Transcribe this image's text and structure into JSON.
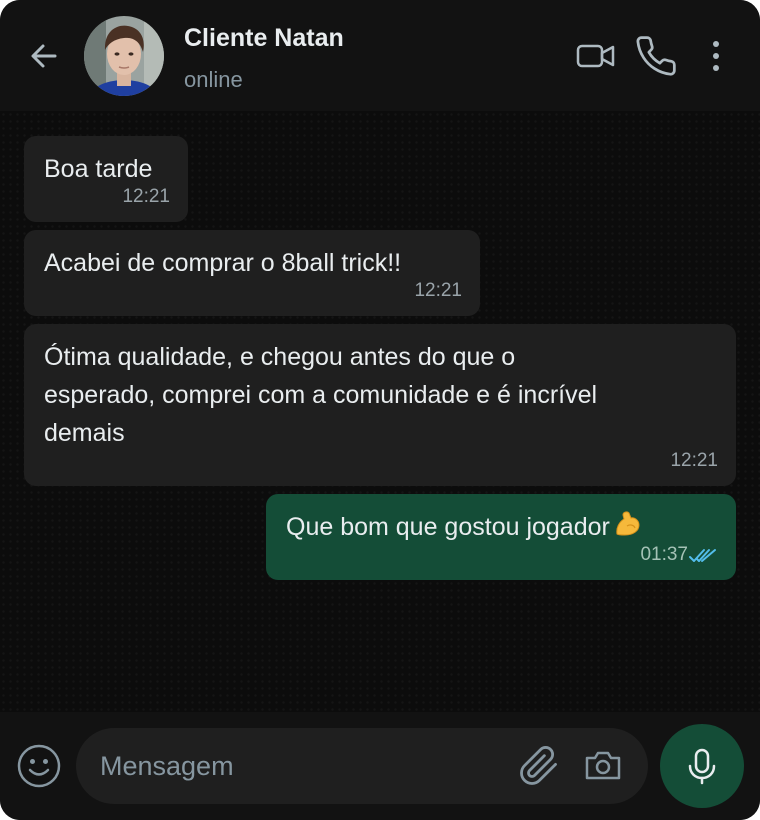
{
  "header": {
    "contact_name": "Cliente Natan",
    "status": "online",
    "icons": [
      "back-arrow-icon",
      "avatar",
      "video-call-icon",
      "phone-icon",
      "more-vert-icon"
    ]
  },
  "messages": [
    {
      "direction": "incoming",
      "lines": [
        "Boa tarde"
      ],
      "time": "12:21"
    },
    {
      "direction": "incoming",
      "lines": [
        "Acabei de comprar o 8ball trick!!"
      ],
      "time": "12:21"
    },
    {
      "direction": "incoming",
      "lines": [
        "Ótima qualidade, e chegou antes do que o",
        "esperado, comprei com a comunidade e é incrível",
        "demais"
      ],
      "time": "12:21"
    },
    {
      "direction": "outgoing",
      "lines": [
        "Que bom que gostou jogador"
      ],
      "emoji": "flexed-biceps",
      "time": "01:37",
      "read": true
    }
  ],
  "composer": {
    "placeholder": "Mensagem",
    "icons": [
      "emoji-icon",
      "attach-icon",
      "camera-icon",
      "mic-icon"
    ]
  },
  "colors": {
    "app_background": "#0b0b0b",
    "header_background": "#121212",
    "incoming_bubble": "#1f1f1f",
    "outgoing_bubble": "#144d37",
    "read_ticks": "#53bdeb",
    "primary_text": "#e9edef",
    "secondary_text": "#8696a0"
  }
}
